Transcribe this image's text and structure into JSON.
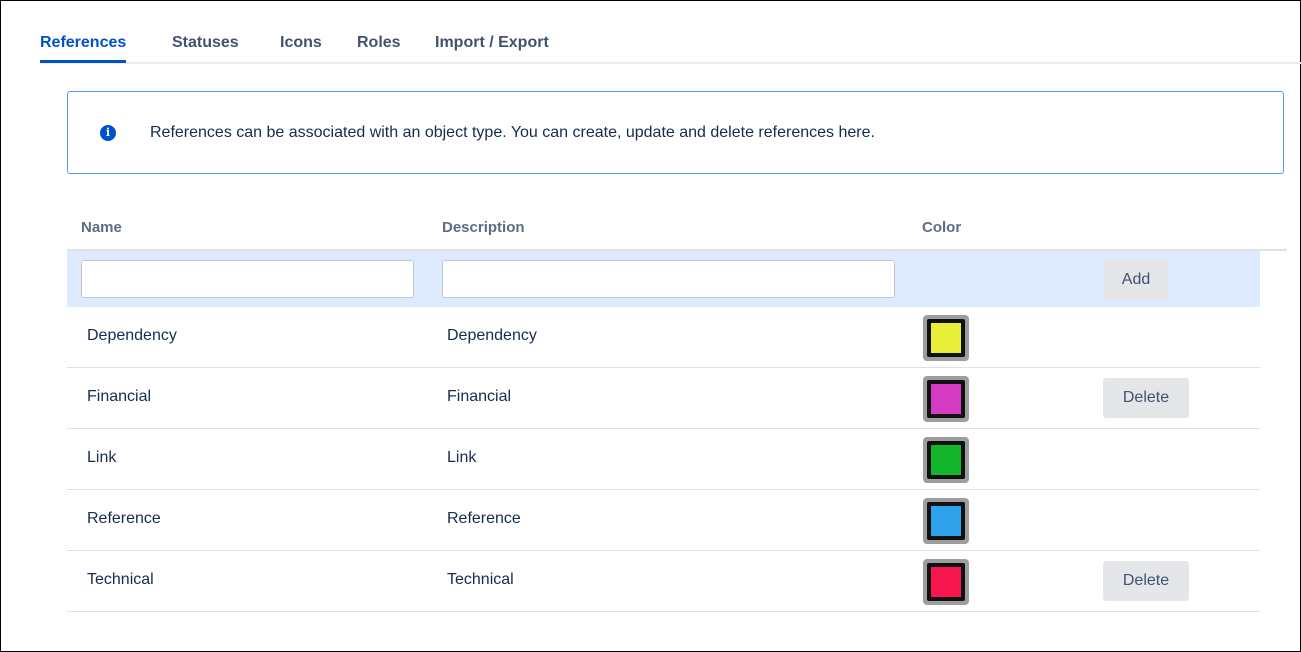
{
  "tabs": [
    {
      "label": "References",
      "active": true
    },
    {
      "label": "Statuses",
      "active": false
    },
    {
      "label": "Icons",
      "active": false
    },
    {
      "label": "Roles",
      "active": false
    },
    {
      "label": "Import / Export",
      "active": false
    }
  ],
  "info": {
    "icon": "info-icon",
    "text": "References can be associated with an object type. You can create, update and delete references here."
  },
  "table": {
    "headers": {
      "name": "Name",
      "description": "Description",
      "color": "Color"
    },
    "new_row": {
      "name_value": "",
      "description_value": "",
      "add_label": "Add"
    },
    "rows": [
      {
        "name": "Dependency",
        "description": "Dependency",
        "color": "#e8f03a",
        "delete_label": ""
      },
      {
        "name": "Financial",
        "description": "Financial",
        "color": "#d63bc4",
        "delete_label": "Delete"
      },
      {
        "name": "Link",
        "description": "Link",
        "color": "#12b52c",
        "delete_label": ""
      },
      {
        "name": "Reference",
        "description": "Reference",
        "color": "#2ea3eb",
        "delete_label": ""
      },
      {
        "name": "Technical",
        "description": "Technical",
        "color": "#f5174e",
        "delete_label": "Delete"
      }
    ]
  },
  "colors": {
    "accent": "#0052cc",
    "info_border": "#4c9aff",
    "add_row_bg": "#deebff"
  }
}
